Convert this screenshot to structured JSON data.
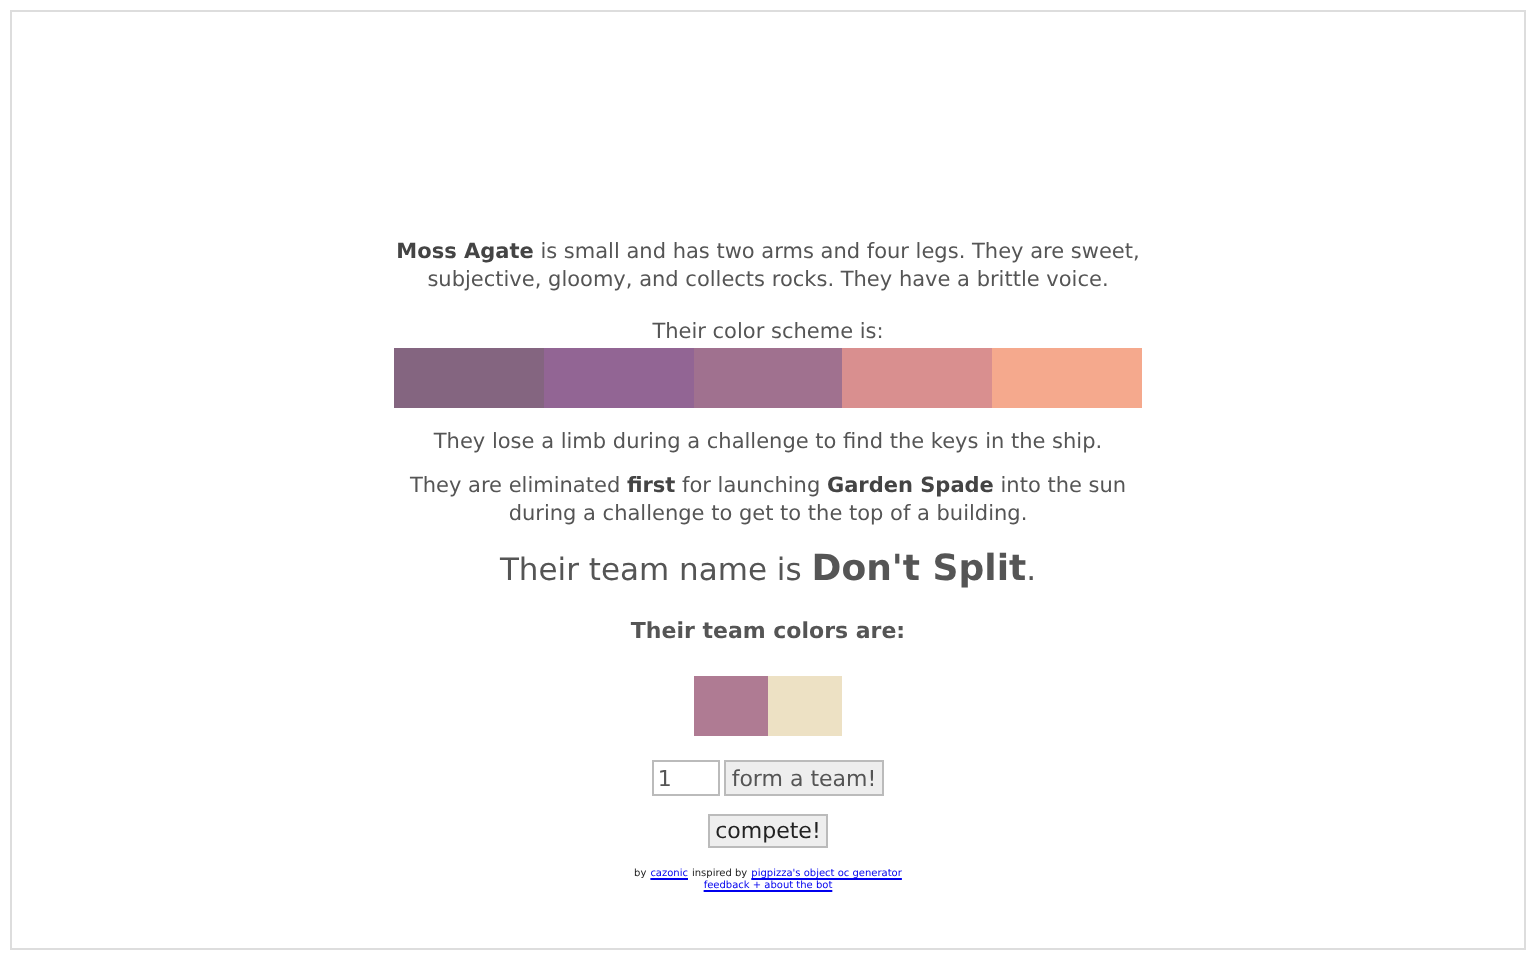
{
  "description": "**Moss Agate** is small and has two arms and four legs. They are sweet, subjective, gloomy, and collects rocks. They have a brittle voice.",
  "scheme_label": "Their color scheme is:",
  "scheme": [
    {
      "color": "#846580"
    },
    {
      "color": "#926594"
    },
    {
      "color": "#a0718f"
    },
    {
      "color": "#d98f8f"
    },
    {
      "color": "#f5a98d"
    }
  ],
  "events": [
    "They lose a limb during a challenge to find the keys in the ship.",
    "They are eliminated **first** for launching **Garden Spade** into the sun during a challenge to get to the top of a building."
  ],
  "team_intro": "Their team name is",
  "team_name": "Don't Split",
  "team_end": ".",
  "team_colors_label": "Their team colors are:",
  "team_colors": [
    {
      "color": "#af7b93"
    },
    {
      "color": "#ede1c4"
    }
  ],
  "team_size": {
    "value": "1"
  },
  "form_button": "form a team!",
  "compete_button": "compete!",
  "footer": {
    "by": "by",
    "author": "cazonic",
    "inspired": "inspired by",
    "inspired_link": "pigpizza's object oc generator",
    "feedback": "feedback + about the bot"
  }
}
